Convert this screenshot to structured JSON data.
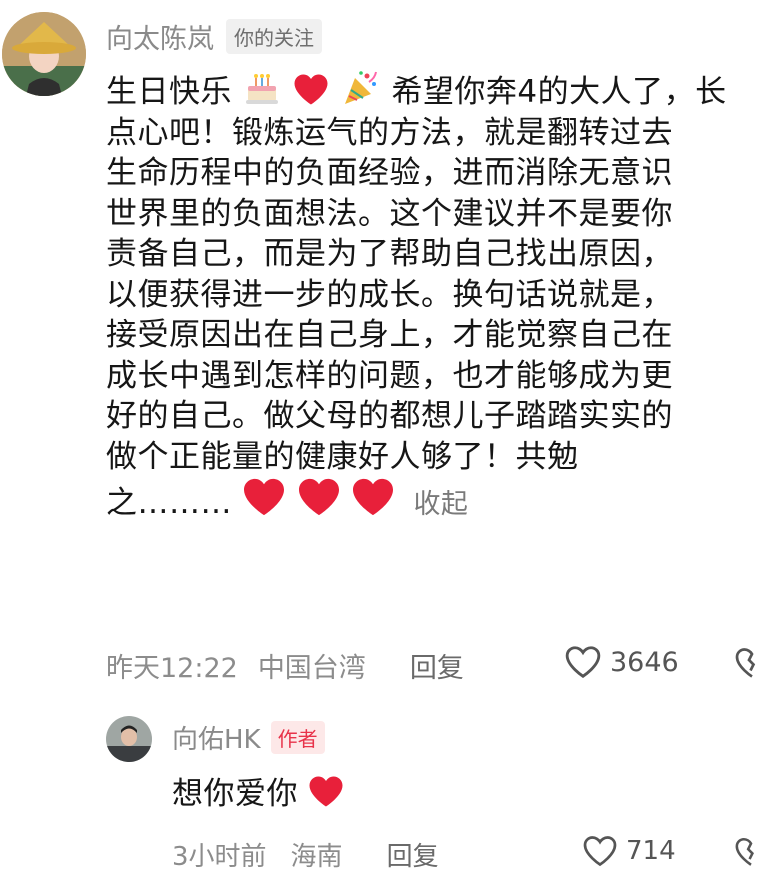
{
  "comment1": {
    "author": "向太陈岚",
    "tag": "你的关注",
    "lines": [
      "生日快乐",
      "希望你奔4的大人了，长",
      "点心吧！锻炼运气的方法，就是翻转过去",
      "生命历程中的负面经验，进而消除无意识",
      "世界里的负面想法。这个建议并不是要你",
      "责备自己，而是为了帮助自己找出原因，",
      "以便获得进一步的成长。换句话说就是，",
      "接受原因出在自己身上，才能觉察自己在",
      "成长中遇到怎样的问题，也才能够成为更",
      "好的自己。做父母的都想儿子踏踏实实的",
      "做个正能量的健康好人够了！共勉",
      "之………"
    ],
    "collapse_label": "收起",
    "time": "昨天12:22",
    "location": "中国台湾",
    "reply_label": "回复",
    "likes": "3646"
  },
  "comment2": {
    "author": "向佑HK",
    "tag": "作者",
    "text": "想你爱你",
    "time": "3小时前",
    "location": "海南",
    "reply_label": "回复",
    "likes": "714"
  },
  "icons": {
    "heart": "red-heart-emoji",
    "cake": "birthday-cake-emoji",
    "popper": "party-popper-emoji",
    "like": "heart-outline-icon",
    "dislike": "broken-heart-outline-icon"
  },
  "colors": {
    "heart_red": "#e8203a",
    "author_tag": "#e8334a",
    "meta_gray": "#8c8c8c"
  }
}
